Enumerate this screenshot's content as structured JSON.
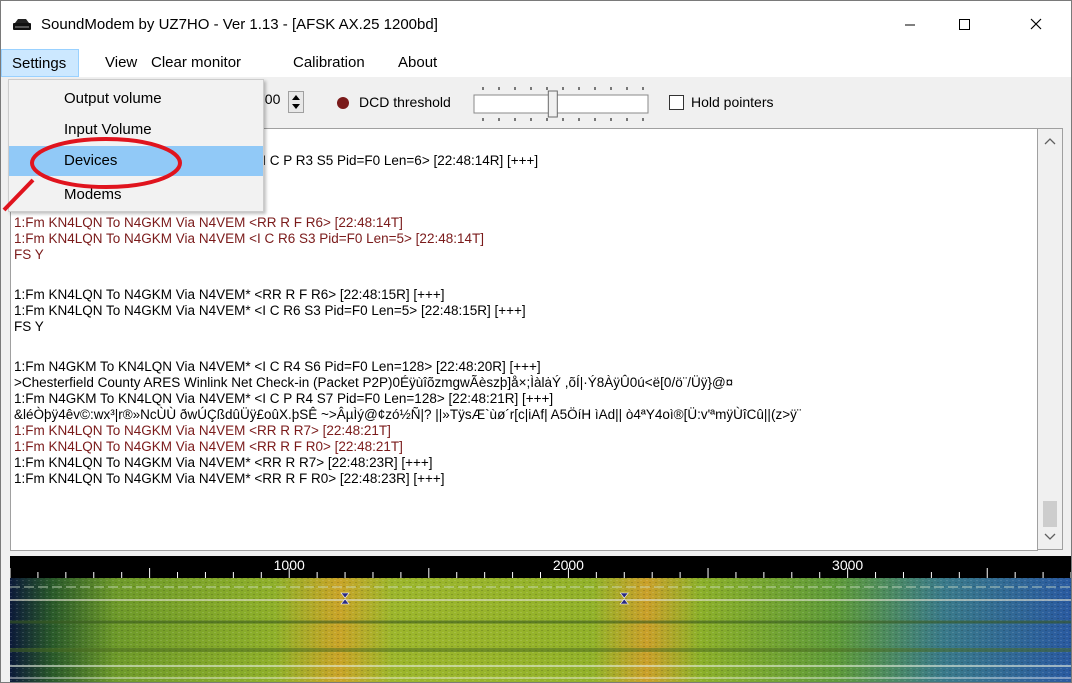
{
  "window": {
    "title": "SoundModem by UZ7HO - Ver 1.13 - [AFSK AX.25 1200bd]",
    "icon": "modem-icon",
    "controls": [
      "minimize-icon",
      "maximize-icon",
      "close-icon"
    ]
  },
  "menubar": {
    "settings": "Settings",
    "view": "View",
    "clear_monitor": "Clear monitor",
    "calibration": "Calibration",
    "about": "About"
  },
  "settings_menu": {
    "output_volume": "Output volume",
    "input_volume": "Input Volume",
    "devices": "Devices",
    "modems": "Modems"
  },
  "toolbar": {
    "frequency_value": "700",
    "dcd_label": "DCD threshold",
    "dcd_threshold": 0.45,
    "hold_pointers_label": "Hold pointers",
    "hold_pointers_checked": false
  },
  "monitor": {
    "lines": [
      {
        "text": "1:Fm KN4LQN To N4GKM Via N4VEM* <I C P R3 S5 Pid=F0 Len=6> [22:48:14R] [+++]",
        "color": "black"
      },
      {
        "text": "1:Fm KN4LQN To N4GKM Via N4VEM <RR R F R6> [22:48:14T]",
        "color": "red"
      },
      {
        "text": "1:Fm KN4LQN To N4GKM Via N4VEM <I C R6 S3 Pid=F0 Len=5> [22:48:14T]",
        "color": "red"
      },
      {
        "text": "FS Y",
        "color": "red"
      },
      {
        "text": "1:Fm KN4LQN To N4GKM Via N4VEM* <RR R F R6> [22:48:15R] [+++]",
        "color": "black"
      },
      {
        "text": "1:Fm KN4LQN To N4GKM Via N4VEM* <I C R6 S3 Pid=F0 Len=5> [22:48:15R] [+++]",
        "color": "black"
      },
      {
        "text": "FS Y",
        "color": "black"
      },
      {
        "text": "1:Fm N4GKM To KN4LQN Via N4VEM* <I C R4 S6 Pid=F0 Len=128> [22:48:20R] [+++]",
        "color": "black"
      },
      {
        "text": ">Chesterfield County ARES Winlink Net Check-in (Packet P2P)0ÉÿùîõzmgwÃèszþ]å×;ÌàlȧÝ ,õÍ|·Ý8ÀÿÛ0ú<ë[0/ö¨/Üÿ}@¤",
        "color": "black"
      },
      {
        "text": "1:Fm N4GKM To KN4LQN Via N4VEM* <I C P R4 S7 Pid=F0 Len=128> [22:48:21R] [+++]",
        "color": "black"
      },
      {
        "text": "&léÒþÿ4êv©:wx³|r®»NcÙÙ ðwÚÇßdûÜÿ£oûX.þSÊ ~>ÂµÌý@¢zó½Ñ|? ||»TÿsÆ`ùø´r[c|iAf|  A5ÖíH ìAd|| ò4ªY4oì®[Ü:v'ªmÿÙîCû||(z>ÿ¨",
        "color": "black"
      },
      {
        "text": "1:Fm KN4LQN To N4GKM Via N4VEM <RR R R7> [22:48:21T]",
        "color": "red"
      },
      {
        "text": "1:Fm KN4LQN To N4GKM Via N4VEM <RR R F R0> [22:48:21T]",
        "color": "red"
      },
      {
        "text": "1:Fm KN4LQN To N4GKM Via N4VEM* <RR R R7> [22:48:23R] [+++]",
        "color": "black"
      },
      {
        "text": "1:Fm KN4LQN To N4GKM Via N4VEM* <RR R F R0> [22:48:23R] [+++]",
        "color": "black"
      }
    ]
  },
  "waterfall": {
    "freq_labels": [
      "1000",
      "2000",
      "3000"
    ],
    "freq_range": [
      0,
      3800
    ],
    "markers_hz": [
      1200,
      2200
    ]
  },
  "colors": {
    "tx_text": "#7a1a1a",
    "rx_text": "#000000",
    "menu_highlight": "#91c9f7",
    "annotation": "#e0141e"
  }
}
